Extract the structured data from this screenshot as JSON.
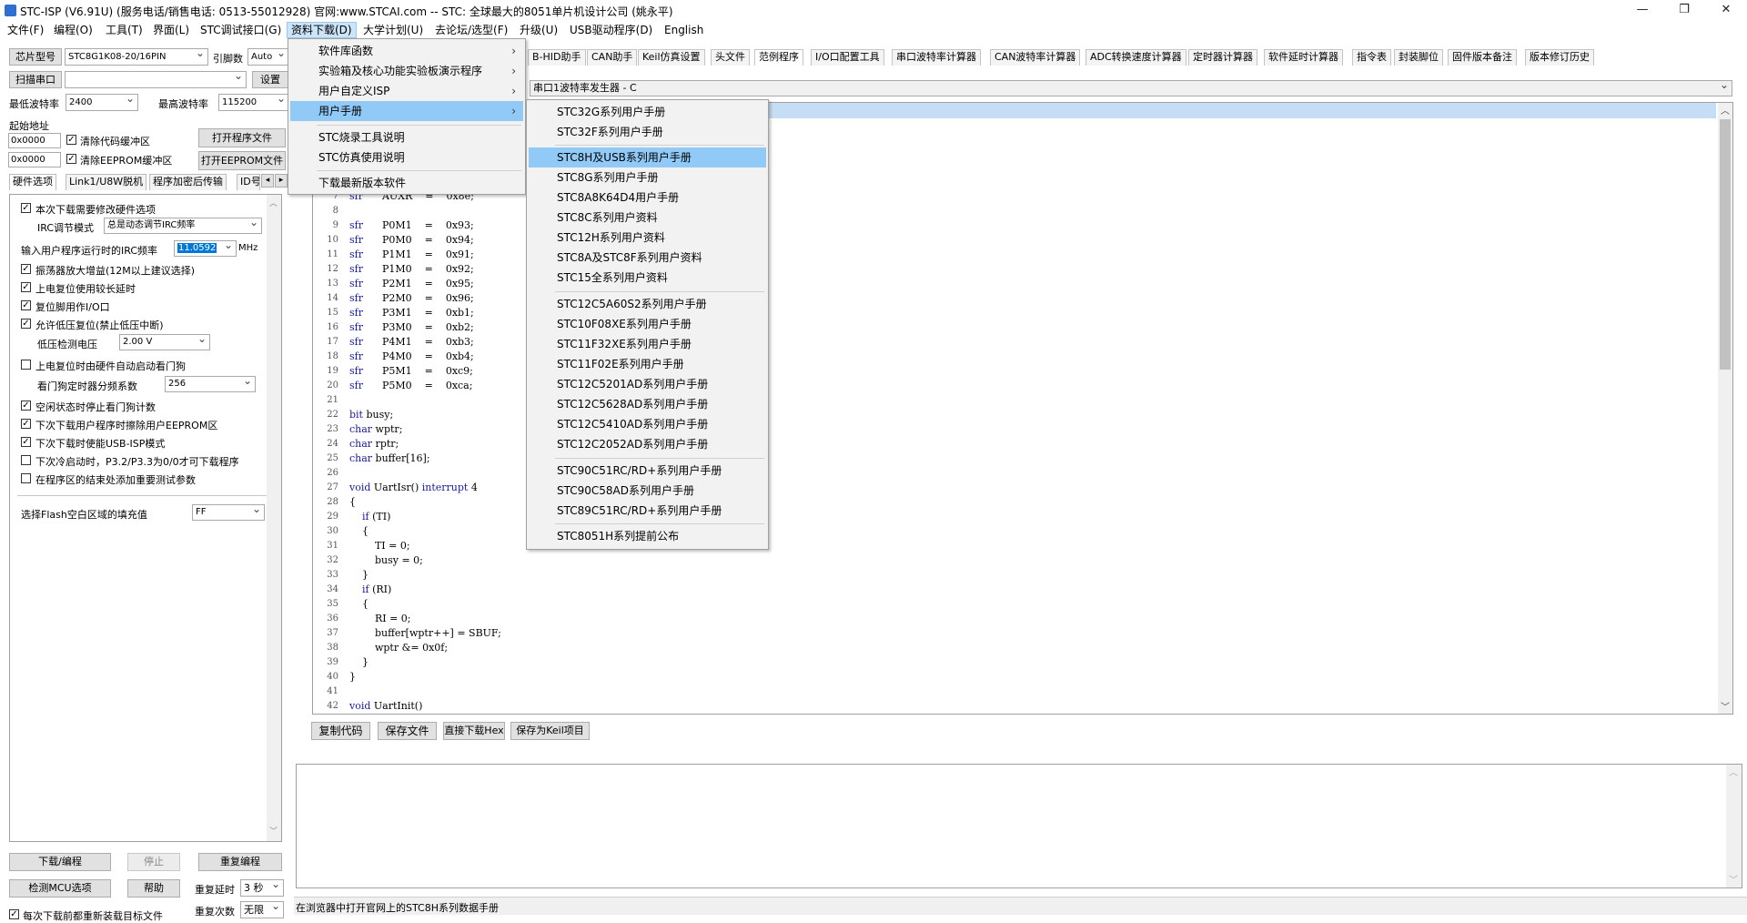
{
  "window": {
    "title": "STC-ISP (V6.91U) (服务电话/销售电话: 0513-55012928) 官网:www.STCAI.com  -- STC: 全球最大的8051单片机设计公司 (姚永平)",
    "minimize": "—",
    "restore": "❐",
    "close": "✕"
  },
  "menubar": [
    "文件(F)",
    "编程(O)",
    "工具(T)",
    "界面(L)",
    "STC调试接口(G)",
    "资料下载(D)",
    "大学计划(U)",
    "去论坛/选型(F)",
    "升级(U)",
    "USB驱动程序(D)",
    "English"
  ],
  "left": {
    "chip_label": "芯片型号",
    "chip_value": "STC8G1K08-20/16PIN",
    "pins_label": "引脚数",
    "pins_value": "Auto",
    "scan_port": "扫描串口",
    "port_value": "",
    "settings": "设置",
    "min_baud_label": "最低波特率",
    "min_baud": "2400",
    "max_baud_label": "最高波特率",
    "max_baud": "115200",
    "start_addr_label": "起始地址",
    "addr1": "0x0000",
    "clear_code": "清除代码缓冲区",
    "open_prog": "打开程序文件",
    "addr2": "0x0000",
    "clear_eeprom": "清除EEPROM缓冲区",
    "open_eeprom": "打开EEPROM文件",
    "tabs": [
      "硬件选项",
      "Link1/U8W脱机",
      "程序加密后传输",
      "ID号"
    ],
    "hw": {
      "modify_hw": "本次下载需要修改硬件选项",
      "irc_mode_label": "IRC调节模式",
      "irc_mode_value": "总是动态调节IRC频率",
      "irc_freq_label": "输入用户程序运行时的IRC频率",
      "irc_freq_value": "11.0592",
      "irc_unit": "MHz",
      "osc_gain": "振荡器放大增益(12M以上建议选择)",
      "long_reset": "上电复位使用较长延时",
      "reset_io": "复位脚用作I/O口",
      "lvr": "允许低压复位(禁止低压中断)",
      "lvd_label": "低压检测电压",
      "lvd_value": "2.00 V",
      "wdt_hw": "上电复位时由硬件自动启动看门狗",
      "wdt_div_label": "看门狗定时器分频系数",
      "wdt_div_value": "256",
      "wdt_idle": "空闲状态时停止看门狗计数",
      "erase_eeprom": "下次下载用户程序时擦除用户EEPROM区",
      "usb_isp": "下次下载时使能USB-ISP模式",
      "cold_boot": "下次冷启动时，P3.2/P3.3为0/0才可下载程序",
      "add_params": "在程序区的结束处添加重要测试参数",
      "flash_fill_label": "选择Flash空白区域的填充值",
      "flash_fill_value": "FF"
    },
    "download": "下载/编程",
    "stop": "停止",
    "reprogram": "重复编程",
    "check_mcu": "检测MCU选项",
    "help": "帮助",
    "repeat_delay_label": "重复延时",
    "repeat_delay": "3 秒",
    "repeat_count_label": "重复次数",
    "repeat_count": "无限",
    "reload": "每次下载前都重新装载目标文件"
  },
  "right_tabs": [
    "B-HID助手",
    "CAN助手",
    "Keil仿真设置",
    "头文件",
    "范例程序",
    "I/O口配置工具",
    "串口波特率计算器",
    "CAN波特率计算器",
    "ADC转换速度计算器",
    "定时器计算器",
    "软件延时计算器",
    "指令表",
    "封装脚位",
    "固件版本备注",
    "版本修订历史"
  ],
  "example_select": "串口1波特率发生器 - C",
  "code_lines": [
    {
      "n": "7",
      "t": "sfr      AUXR    =    0x8e;"
    },
    {
      "n": "8",
      "t": ""
    },
    {
      "n": "9",
      "t": "sfr      P0M1    =    0x93;"
    },
    {
      "n": "10",
      "t": "sfr      P0M0    =    0x94;"
    },
    {
      "n": "11",
      "t": "sfr      P1M1    =    0x91;"
    },
    {
      "n": "12",
      "t": "sfr      P1M0    =    0x92;"
    },
    {
      "n": "13",
      "t": "sfr      P2M1    =    0x95;"
    },
    {
      "n": "14",
      "t": "sfr      P2M0    =    0x96;"
    },
    {
      "n": "15",
      "t": "sfr      P3M1    =    0xb1;"
    },
    {
      "n": "16",
      "t": "sfr      P3M0    =    0xb2;"
    },
    {
      "n": "17",
      "t": "sfr      P4M1    =    0xb3;"
    },
    {
      "n": "18",
      "t": "sfr      P4M0    =    0xb4;"
    },
    {
      "n": "19",
      "t": "sfr      P5M1    =    0xc9;"
    },
    {
      "n": "20",
      "t": "sfr      P5M0    =    0xca;"
    },
    {
      "n": "21",
      "t": ""
    },
    {
      "n": "22",
      "t": "bit busy;"
    },
    {
      "n": "23",
      "t": "char wptr;"
    },
    {
      "n": "24",
      "t": "char rptr;"
    },
    {
      "n": "25",
      "t": "char buffer[16];"
    },
    {
      "n": "26",
      "t": ""
    },
    {
      "n": "27",
      "t": "void UartIsr() interrupt 4"
    },
    {
      "n": "28",
      "t": "{"
    },
    {
      "n": "29",
      "t": "    if (TI)"
    },
    {
      "n": "30",
      "t": "    {"
    },
    {
      "n": "31",
      "t": "        TI = 0;"
    },
    {
      "n": "32",
      "t": "        busy = 0;"
    },
    {
      "n": "33",
      "t": "    }"
    },
    {
      "n": "34",
      "t": "    if (RI)"
    },
    {
      "n": "35",
      "t": "    {"
    },
    {
      "n": "36",
      "t": "        RI = 0;"
    },
    {
      "n": "37",
      "t": "        buffer[wptr++] = SBUF;"
    },
    {
      "n": "38",
      "t": "        wptr &= 0x0f;"
    },
    {
      "n": "39",
      "t": "    }"
    },
    {
      "n": "40",
      "t": "}"
    },
    {
      "n": "41",
      "t": ""
    },
    {
      "n": "42",
      "t": "void UartInit()"
    }
  ],
  "code_buttons": [
    "复制代码",
    "保存文件",
    "直接下载Hex",
    "保存为Keil项目"
  ],
  "status_text": "在浏览器中打开官网上的STC8H系列数据手册",
  "menu_download": [
    "软件库函数",
    "实验箱及核心功能实验板演示程序",
    "用户自定义ISP",
    "用户手册",
    "STC烧录工具说明",
    "STC仿真使用说明",
    "下载最新版本软件"
  ],
  "menu_manuals": [
    "STC32G系列用户手册",
    "STC32F系列用户手册",
    "STC8H及USB系列用户手册",
    "STC8G系列用户手册",
    "STC8A8K64D4用户手册",
    "STC8C系列用户资料",
    "STC12H系列用户资料",
    "STC8A及STC8F系列用户资料",
    "STC15全系列用户资料",
    "STC12C5A60S2系列用户手册",
    "STC10F08XE系列用户手册",
    "STC11F32XE系列用户手册",
    "STC11F02E系列用户手册",
    "STC12C5201AD系列用户手册",
    "STC12C5628AD系列用户手册",
    "STC12C5410AD系列用户手册",
    "STC12C2052AD系列用户手册",
    "STC90C51RC/RD+系列用户手册",
    "STC90C58AD系列用户手册",
    "STC89C51RC/RD+系列用户手册",
    "STC8051H系列提前公布"
  ],
  "colors": {
    "highlight": "#91c9f7",
    "selection_line": "#c5def5",
    "keyword": "#1a1aa6"
  }
}
